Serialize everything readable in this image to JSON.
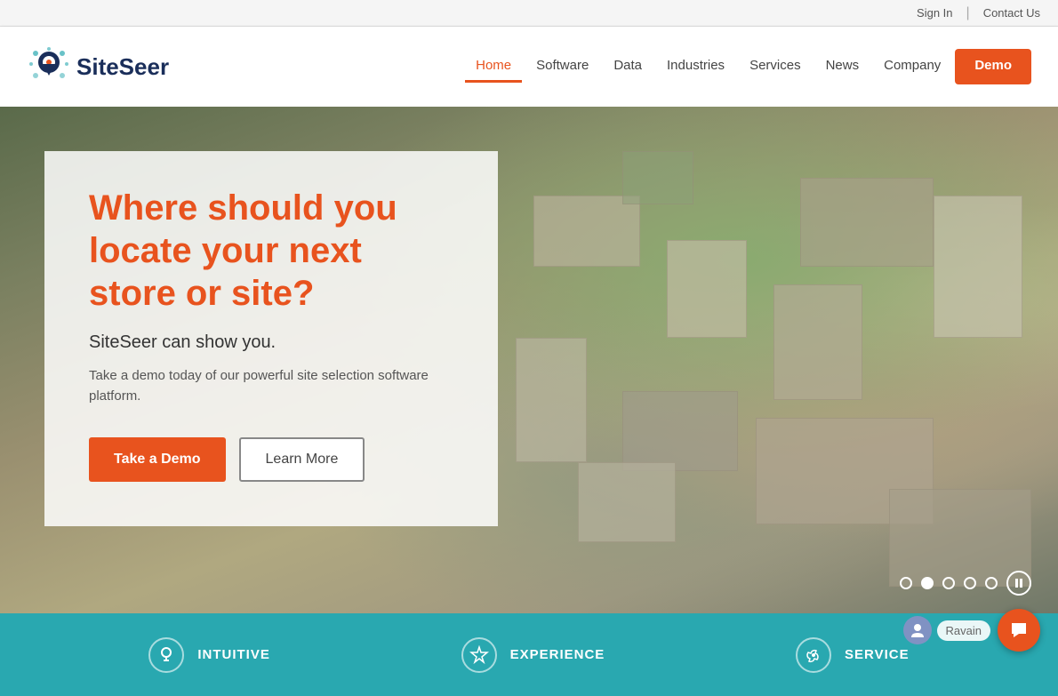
{
  "topbar": {
    "sign_in": "Sign In",
    "contact_us": "Contact Us"
  },
  "header": {
    "logo_text": "SiteSeer",
    "nav": {
      "home": "Home",
      "software": "Software",
      "data": "Data",
      "industries": "Industries",
      "services": "Services",
      "news": "News",
      "company": "Company",
      "demo": "Demo"
    }
  },
  "hero": {
    "headline": "Where should you locate your next store or site?",
    "subheadline": "SiteSeer can show you.",
    "body": "Take a demo today of our powerful site selection software platform.",
    "btn_demo": "Take a Demo",
    "btn_learn": "Learn More"
  },
  "carousel": {
    "dots": [
      1,
      2,
      3,
      4,
      5
    ],
    "active_dot": 2
  },
  "bottom": {
    "items": [
      {
        "label": "INTUITIVE",
        "icon": "💡"
      },
      {
        "label": "EXPERIENCE",
        "icon": "⭐"
      },
      {
        "label": "SERVICE",
        "icon": "🛠"
      }
    ]
  },
  "chat": {
    "label": "Ravain",
    "icon": "💬"
  }
}
